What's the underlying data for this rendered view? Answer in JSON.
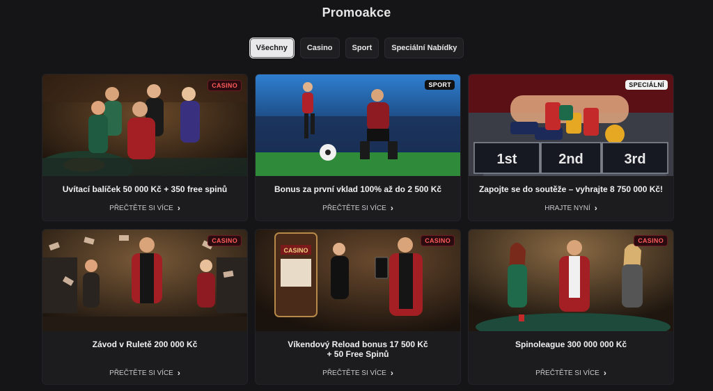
{
  "page": {
    "title": "Promoakce"
  },
  "filters": [
    {
      "label": "Všechny",
      "active": true
    },
    {
      "label": "Casino",
      "active": false
    },
    {
      "label": "Sport",
      "active": false
    },
    {
      "label": "Speciální Nabídky",
      "active": false
    }
  ],
  "cards": [
    {
      "badge": "CASINO",
      "title": "Uvítací balíček 50 000 Kč + 350 free spinů",
      "link": "PŘEČTĚTE SI VÍCE"
    },
    {
      "badge": "SPORT",
      "title": "Bonus za první vklad 100% až do 2 500 Kč",
      "link": "PŘEČTĚTE SI VÍCE"
    },
    {
      "badge": "SPECIÁLNÍ",
      "title": "Zapojte se do soutěže – vyhrajte 8 750 000 Kč!",
      "link": "HRAJTE NYNÍ",
      "image_text": [
        "1st",
        "2nd",
        "3rd"
      ]
    },
    {
      "badge": "CASINO",
      "title": "Závod v Ruletě 200 000 Kč",
      "link": "PŘEČTĚTE SI VÍCE"
    },
    {
      "badge": "CASINO",
      "title_line1": "Víkendový Reload bonus 17 500 Kč",
      "title_line2": "+ 50 Free Spinů",
      "link": "PŘEČTĚTE SI VÍCE",
      "image_text": [
        "CASINO"
      ]
    },
    {
      "badge": "CASINO",
      "title": "Spinoleague 300 000 000 Kč",
      "link": "PŘEČTĚTE SI VÍCE"
    }
  ],
  "colors": {
    "background": "#151517",
    "card": "#1c1c1f",
    "casino_badge": "#ff5a5a",
    "active_filter": "#e9e9eb"
  }
}
